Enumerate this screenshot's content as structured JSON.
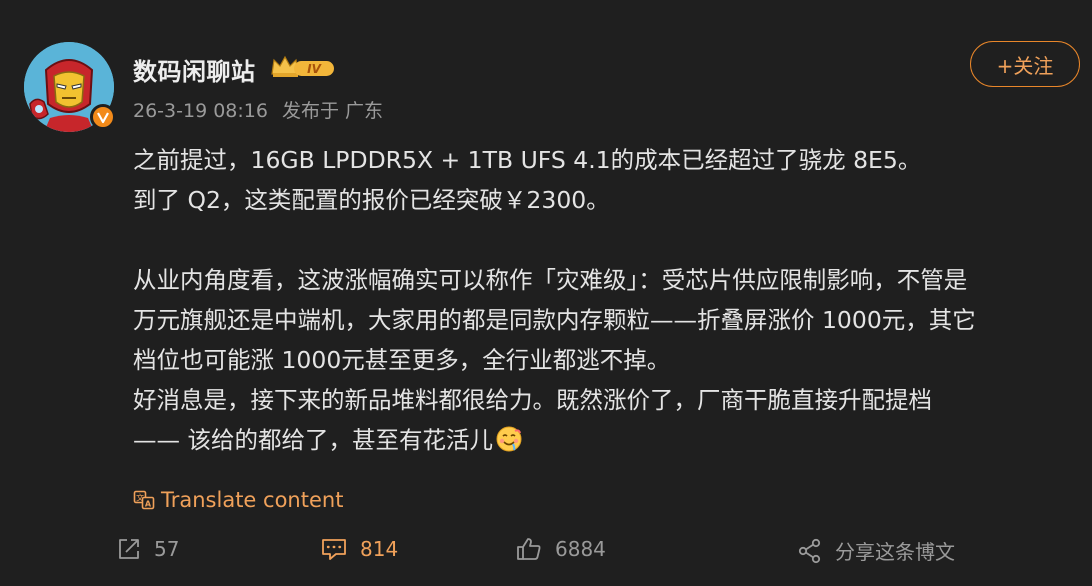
{
  "author": {
    "name": "数码闲聊站",
    "vip_level": "IV",
    "timestamp": "26-3-19 08:16",
    "location": "发布于 广东"
  },
  "follow_button": {
    "label": "+关注"
  },
  "post": {
    "lines_p1": [
      "之前提过，16GB LPDDR5X + 1TB UFS 4.1的成本已经超过了骁龙 8E5。",
      "到了 Q2，这类配置的报价已经突破￥2300。"
    ],
    "lines_p2": [
      "从业内角度看，这波涨幅确实可以称作「灾难级」：受芯片供应限制影响，不管是",
      "万元旗舰还是中端机，大家用的都是同款内存颗粒——折叠屏涨价 1000元，其它",
      "档位也可能涨 1000元甚至更多，全行业都逃不掉。",
      "好消息是，接下来的新品堆料都很给力。既然涨价了，厂商干脆直接升配提档",
      "—— 该给的都给了，甚至有花活儿"
    ]
  },
  "translate_label": "Translate content",
  "actions": {
    "repost_count": "57",
    "comment_count": "814",
    "like_count": "6884",
    "share_label": "分享这条博文"
  },
  "colors": {
    "background": "#1f1f1f",
    "accent": "#f0a15a",
    "muted": "#9a9a9a"
  }
}
